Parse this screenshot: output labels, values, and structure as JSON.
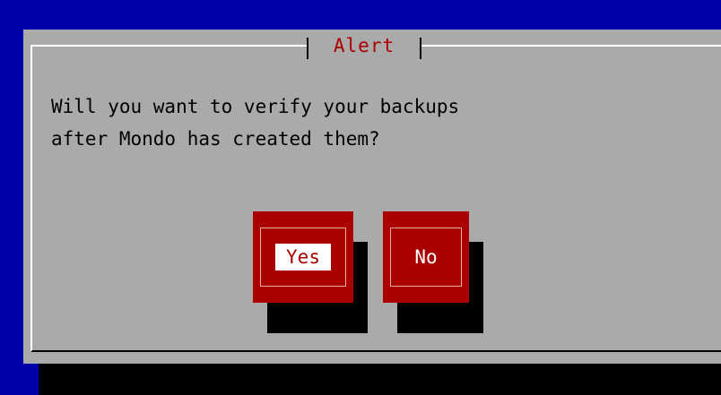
{
  "dialog": {
    "title": "Alert",
    "message_lines": [
      "Will you want to verify your backups",
      "after Mondo has created them?"
    ],
    "buttons": {
      "yes_label": "Yes",
      "no_label": "No"
    }
  },
  "colors": {
    "desktop": "#0000ab",
    "dialog_bg": "#aaaaaa",
    "title_text": "#aa0000",
    "button_bg": "#aa0000",
    "selected_label_bg": "#ffffff",
    "shadow": "#000000"
  }
}
